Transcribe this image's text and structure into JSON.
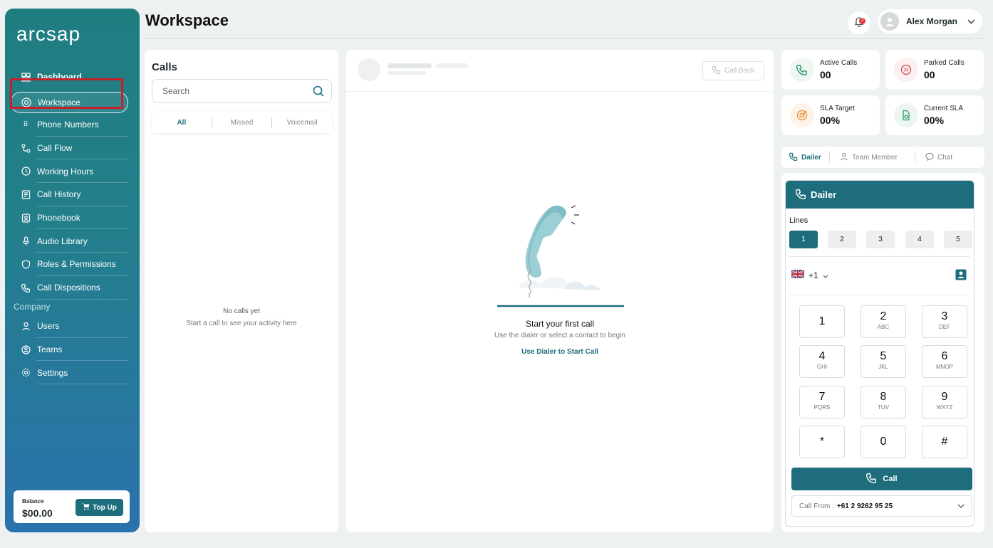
{
  "app": {
    "logo": "arcsap",
    "page_title": "Workspace"
  },
  "sidebar": {
    "items": [
      {
        "label": "Dashboard",
        "icon": "grid-icon"
      },
      {
        "label": "Workspace",
        "icon": "lifebuoy-icon"
      },
      {
        "label": "Phone Numbers",
        "icon": "keypad-icon"
      },
      {
        "label": "Call Flow",
        "icon": "flow-icon"
      },
      {
        "label": "Working Hours",
        "icon": "clock-icon"
      },
      {
        "label": "Call History",
        "icon": "history-icon"
      },
      {
        "label": "Phonebook",
        "icon": "phonebook-icon"
      },
      {
        "label": "Audio Library",
        "icon": "mic-icon"
      },
      {
        "label": "Roles & Permissions",
        "icon": "shield-icon"
      },
      {
        "label": "Call Dispositions",
        "icon": "phone-icon"
      }
    ],
    "company_label": "Company",
    "company_items": [
      {
        "label": "Users",
        "icon": "user-icon"
      },
      {
        "label": "Teams",
        "icon": "teams-icon"
      },
      {
        "label": "Settings",
        "icon": "gear-icon"
      }
    ],
    "balance": {
      "label": "Balance",
      "amount": "$00.00",
      "topup_label": "Top Up"
    }
  },
  "header": {
    "user_name": "Alex Morgan",
    "notification_count": "2"
  },
  "calls": {
    "title": "Calls",
    "search_placeholder": "Search",
    "filters": [
      "All",
      "Missed",
      "Voicemail"
    ],
    "empty_title": "No calls yet",
    "empty_subtitle": "Start a call to see your activity here"
  },
  "center": {
    "callback_label": "Call Back",
    "title": "Start your first call",
    "subtitle": "Use the dialer or select a contact to begin",
    "link": "Use Dialer to Start Call"
  },
  "stats": [
    {
      "label": "Active Calls",
      "value": "00",
      "color": "#2e9a6b"
    },
    {
      "label": "Parked Calls",
      "value": "00",
      "color": "#d04848"
    },
    {
      "label": "SLA Target",
      "value": "00%",
      "color": "#e58b2a"
    },
    {
      "label": "Current SLA",
      "value": "00%",
      "color": "#2e9a6b"
    }
  ],
  "right_tabs": [
    "Dailer",
    "Team Member",
    "Chat"
  ],
  "dialer": {
    "title": "Dailer",
    "lines_label": "Lines",
    "lines": [
      "1",
      "2",
      "3",
      "4",
      "5"
    ],
    "country_code": "+1",
    "keys": [
      {
        "n": "1",
        "l": ""
      },
      {
        "n": "2",
        "l": "ABC"
      },
      {
        "n": "3",
        "l": "DEF"
      },
      {
        "n": "4",
        "l": "GHI"
      },
      {
        "n": "5",
        "l": "JKL"
      },
      {
        "n": "6",
        "l": "MNOP"
      },
      {
        "n": "7",
        "l": "PQRS"
      },
      {
        "n": "8",
        "l": "TUV"
      },
      {
        "n": "9",
        "l": "WXYZ"
      },
      {
        "n": "*",
        "l": ""
      },
      {
        "n": "0",
        "l": ""
      },
      {
        "n": "#",
        "l": ""
      }
    ],
    "call_label": "Call",
    "call_from_label": "Call From :",
    "call_from_number": "+61 2 9262 95 25"
  },
  "colors": {
    "accent": "#1e6d7d",
    "highlight": "#c8202a"
  }
}
